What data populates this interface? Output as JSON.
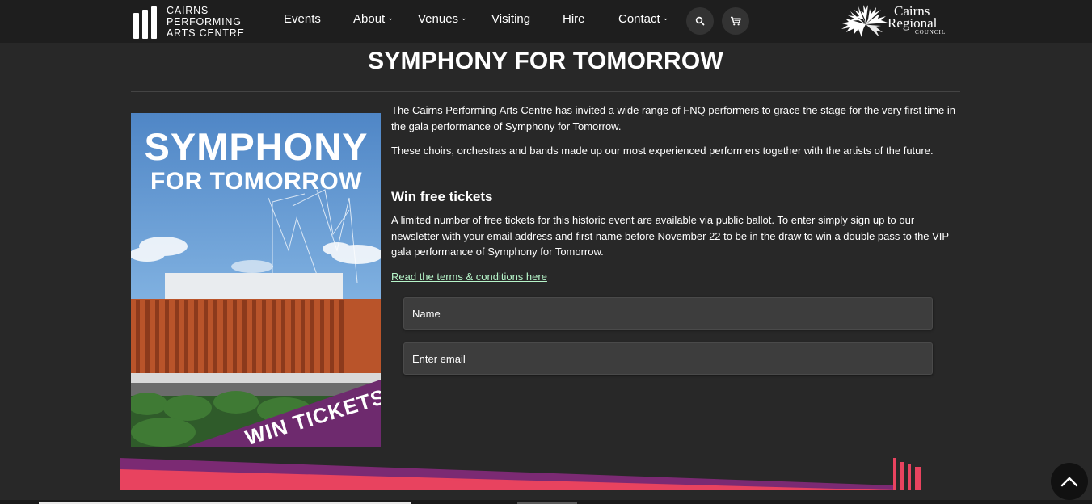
{
  "brand": {
    "line1": "CAIRNS",
    "line2": "PERFORMING",
    "line3": "ARTS CENTRE"
  },
  "nav": {
    "items": [
      {
        "label": "Events",
        "has_dropdown": false
      },
      {
        "label": "About",
        "has_dropdown": true
      },
      {
        "label": "Venues",
        "has_dropdown": true
      },
      {
        "label": "Visiting",
        "has_dropdown": false
      },
      {
        "label": "Hire",
        "has_dropdown": false
      },
      {
        "label": "Contact",
        "has_dropdown": true
      }
    ],
    "search_icon": "search-icon",
    "cart_icon": "cart-icon"
  },
  "council": {
    "line1": "Cairns",
    "line2": "Regional",
    "line3": "COUNCIL"
  },
  "page": {
    "title": "SYMPHONY FOR TOMORROW",
    "intro_1": "The Cairns Performing Arts Centre has invited a wide range of FNQ performers to grace the stage for the very first time in the gala performance of Symphony for Tomorrow.",
    "intro_2": "These choirs, orchestras and bands made up our most experienced performers together with the artists of the future.",
    "win_heading": "Win free tickets",
    "win_text": "A limited number of free tickets for this historic event are available via public ballot. To enter simply sign up to our newsletter with your email address and first name before November 22 to be in the draw to win a double pass to the VIP gala performance of Symphony for Tomorrow.",
    "terms_link": "Read the terms & conditions here"
  },
  "hero": {
    "title_line1": "SYMPHONY",
    "title_line2": "FOR TOMORROW",
    "banner": "WIN TICKETS"
  },
  "form": {
    "name_placeholder": "Name",
    "email_placeholder": "Enter email"
  },
  "colors": {
    "background": "#282828",
    "nav": "#1e1e1e",
    "link": "#b6f5c9",
    "accent_pink": "#e8435f",
    "accent_purple": "#7b2a73"
  }
}
